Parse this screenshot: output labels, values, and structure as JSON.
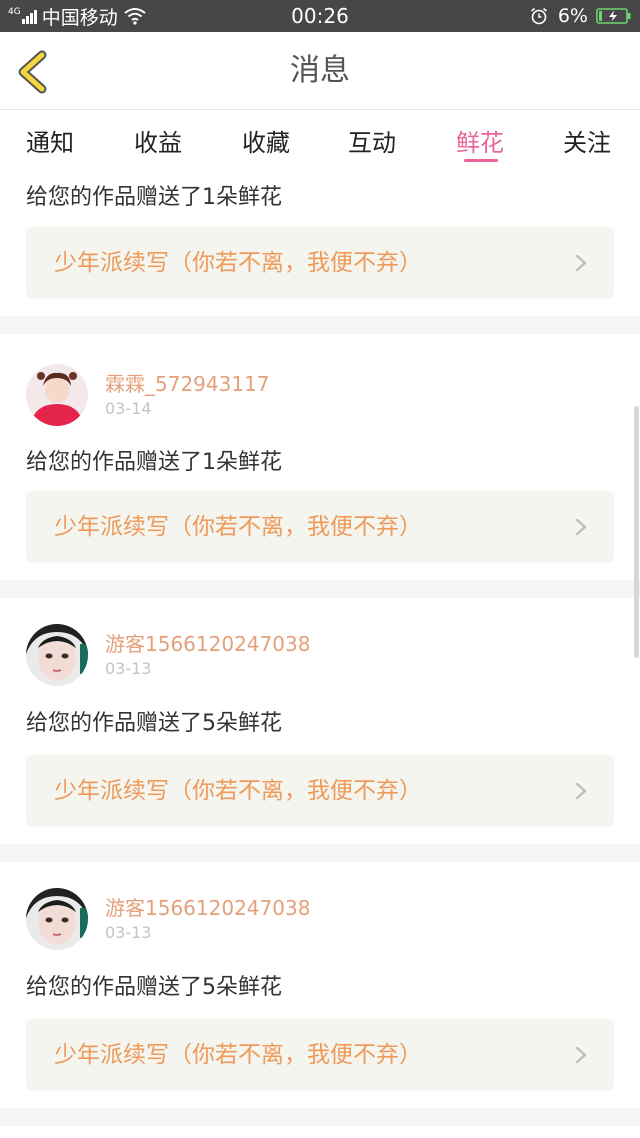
{
  "status_bar": {
    "network_type": "4G",
    "carrier": "中国移动",
    "time": "00:26",
    "battery": "6%"
  },
  "header": {
    "title": "消息",
    "back_icon": "chevron-left-icon"
  },
  "tabs": [
    {
      "label": "通知",
      "active": false
    },
    {
      "label": "收益",
      "active": false
    },
    {
      "label": "收藏",
      "active": false
    },
    {
      "label": "互动",
      "active": false
    },
    {
      "label": "鲜花",
      "active": true
    },
    {
      "label": "关注",
      "active": false
    }
  ],
  "colors": {
    "accent": "#e8649a",
    "username": "#e4a07a",
    "work_title": "#ee9a5a",
    "work_box_bg": "#f5f5ef",
    "separator": "#f5f5f5",
    "status_bar_bg": "#474747"
  },
  "messages": [
    {
      "message": "给您的作品赠送了1朵鲜花",
      "work_title": "少年派续写（你若不离，我便不弃）"
    },
    {
      "username": "霖霖_572943117",
      "date": "03-14",
      "message": "给您的作品赠送了1朵鲜花",
      "work_title": "少年派续写（你若不离，我便不弃）"
    },
    {
      "username": "游客1566120247038",
      "date": "03-13",
      "message": "给您的作品赠送了5朵鲜花",
      "work_title": "少年派续写（你若不离，我便不弃）"
    },
    {
      "username": "游客1566120247038",
      "date": "03-13",
      "message": "给您的作品赠送了5朵鲜花",
      "work_title": "少年派续写（你若不离，我便不弃）"
    }
  ]
}
